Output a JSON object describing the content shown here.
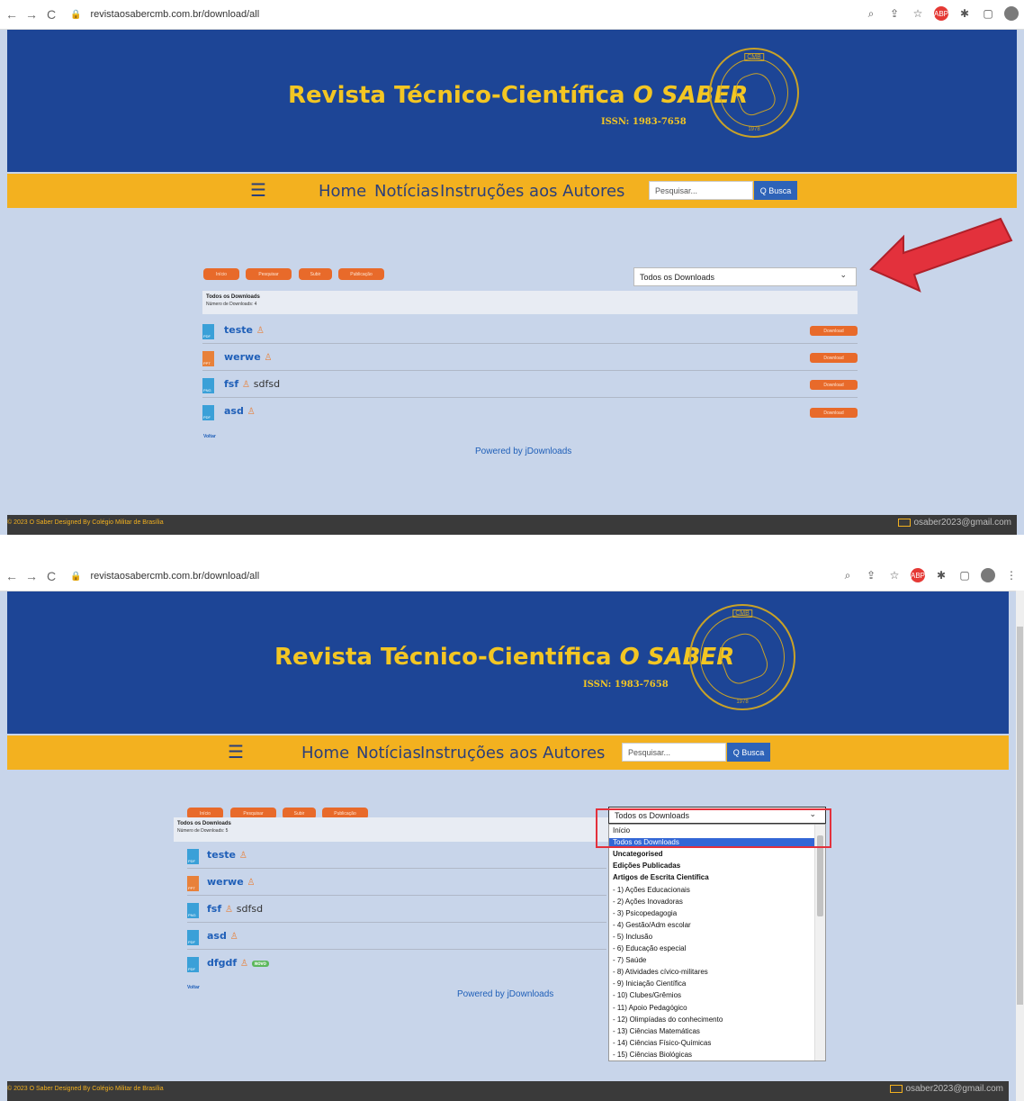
{
  "browser": {
    "url": "revistaosabercmb.com.br/download/all"
  },
  "site": {
    "title_main": "Revista Técnico-Científica",
    "title_accent": "O SABER",
    "issn": "ISSN: 1983-7658",
    "emblem_text": "CMB",
    "emblem_year": "1978"
  },
  "nav": {
    "menu_icon": "hamburger-icon",
    "home": "Home",
    "noticias": "Notícias",
    "instrucoes": "Instruções aos Autores",
    "search_placeholder": "Pesquisar...",
    "search_button": "Q Busca"
  },
  "toolbar_buttons": [
    "Início",
    "Pesquisar",
    "Subir",
    "Publicação"
  ],
  "category_select": {
    "selected": "Todos os Downloads"
  },
  "list_header": {
    "title": "Todos os Downloads"
  },
  "screen1": {
    "count_label": "Número de Downloads: 4",
    "files": [
      {
        "name": "teste",
        "desc": "",
        "ext": "PDF",
        "color": "blue"
      },
      {
        "name": "werwe",
        "desc": "",
        "ext": "PPT",
        "color": "orange"
      },
      {
        "name": "fsf",
        "desc": "sdfsd",
        "ext": "PNG",
        "color": "blue"
      },
      {
        "name": "asd",
        "desc": "",
        "ext": "PDF",
        "color": "blue"
      }
    ]
  },
  "screen2": {
    "count_label": "Número de Downloads: 5",
    "files": [
      {
        "name": "teste",
        "desc": "",
        "ext": "PDF",
        "color": "blue"
      },
      {
        "name": "werwe",
        "desc": "",
        "ext": "PPT",
        "color": "orange"
      },
      {
        "name": "fsf",
        "desc": "sdfsd",
        "ext": "PNG",
        "color": "blue"
      },
      {
        "name": "asd",
        "desc": "",
        "ext": "PDF",
        "color": "blue"
      },
      {
        "name": "dfgdf",
        "desc": "",
        "ext": "PDF",
        "color": "blue",
        "badge": "NOVO"
      }
    ]
  },
  "download_button": "Download",
  "voltar": "Voltar",
  "powered": "Powered by jDownloads",
  "footer": {
    "copyright": "© 2023 O Saber Designed By Colégio Militar de Brasília",
    "email": "osaber2023@gmail.com"
  },
  "dropdown_options": [
    "Início",
    "Todos os Downloads",
    "Uncategorised",
    "Edições Publicadas",
    "Artigos de Escrita Científica",
    "- 1) Ações Educacionais",
    "- 2) Ações Inovadoras",
    "- 3) Psicopedagogia",
    "- 4) Gestão/Adm escolar",
    "- 5) Inclusão",
    "- 6) Educação especial",
    "- 7) Saúde",
    "- 8) Atividades cívico-militares",
    "- 9) Iniciação Científica",
    "- 10) Clubes/Grêmios",
    "- 11) Apoio Pedagógico",
    "- 12) Olimpíadas do conhecimento",
    "- 13) Ciências Matemáticas",
    "- 14) Ciências Físico-Químicas",
    "- 15) Ciências Biológicas"
  ],
  "dropdown_selected_index": 1,
  "colors": {
    "header_blue": "#1d4596",
    "title_yellow": "#f3c623",
    "navbar_orange": "#f3b11f",
    "button_orange": "#e86a2a",
    "link_blue": "#1f5fb8",
    "annotation_red": "#e3313c"
  }
}
